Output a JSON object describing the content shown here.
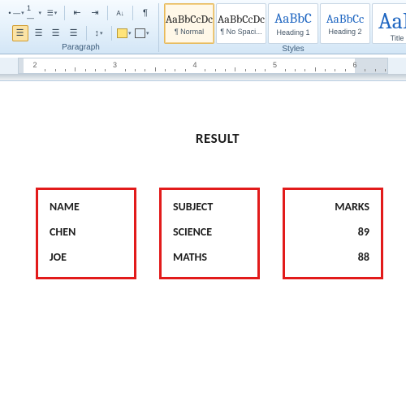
{
  "ribbon": {
    "paragraph_label": "Paragraph",
    "styles_label": "Styles",
    "styles": [
      {
        "preview": "AaBbCcDc",
        "name": "¶ Normal",
        "blue": false
      },
      {
        "preview": "AaBbCcDc",
        "name": "¶ No Spaci...",
        "blue": false
      },
      {
        "preview": "AaBbC",
        "name": "Heading 1",
        "blue": true
      },
      {
        "preview": "AaBbCc",
        "name": "Heading 2",
        "blue": true
      },
      {
        "name": "Title",
        "big": "AaB",
        "blue": true
      }
    ]
  },
  "ruler": {
    "marks": [
      2,
      3,
      4,
      5,
      6
    ]
  },
  "doc": {
    "title": "RESULT",
    "columns": [
      {
        "header": "NAME",
        "rows": [
          "CHEN",
          "JOE"
        ],
        "align": "l"
      },
      {
        "header": "SUBJECT",
        "rows": [
          "SCIENCE",
          "MATHS"
        ],
        "align": "l"
      },
      {
        "header": "MARKS",
        "rows": [
          "89",
          "88"
        ],
        "align": "r"
      }
    ]
  },
  "chart_data": {
    "type": "table",
    "title": "RESULT",
    "columns": [
      "NAME",
      "SUBJECT",
      "MARKS"
    ],
    "rows": [
      [
        "CHEN",
        "SCIENCE",
        89
      ],
      [
        "JOE",
        "MATHS",
        88
      ]
    ]
  }
}
